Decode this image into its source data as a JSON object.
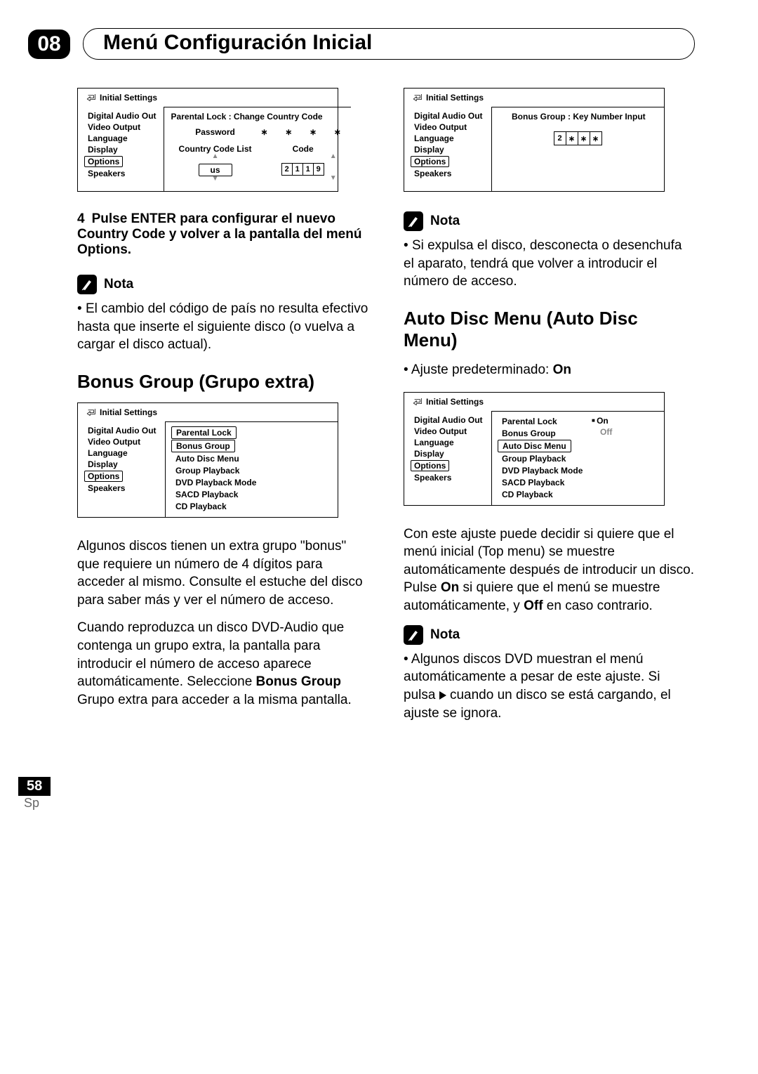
{
  "chapter": {
    "num": "08",
    "title": "Menú Configuración Inicial"
  },
  "page_num": "58",
  "lang": "Sp",
  "panel_title": "Initial Settings",
  "left_menu": {
    "l0": "Digital Audio Out",
    "l1": "Video Output",
    "l2": "Language",
    "l3": "Display",
    "l4": "Options",
    "l5": "Speakers"
  },
  "panel1": {
    "top": "Parental Lock : Change Country Code",
    "password": "Password",
    "cc_list": "Country Code List",
    "code": "Code",
    "us": "us",
    "d0": "2",
    "d1": "1",
    "d2": "1",
    "d3": "9"
  },
  "step4": {
    "num": "4",
    "text_a": "Pulse ENTER para configurar el nuevo Country Code y volver a la pantalla del menú Options."
  },
  "nota": "Nota",
  "note1": "El cambio del código de país no resulta efectivo hasta que inserte el siguiente disco (o vuelva a cargar el disco actual).",
  "h_bonus": "Bonus Group (Grupo extra)",
  "panel2": {
    "o0": "Parental Lock",
    "o1": "Bonus Group",
    "o2": "Auto Disc Menu",
    "o3": "Group Playback",
    "o4": "DVD Playback Mode",
    "o5": "SACD Playback",
    "o6": "CD Playback"
  },
  "bonus_p1": "Algunos discos tienen un extra grupo \"bonus\" que requiere un número de 4 dígitos para acceder al mismo. Consulte el estuche del disco para saber más y ver el número de acceso.",
  "bonus_p2_a": "Cuando reproduzca un disco DVD-Audio que contenga un grupo extra, la pantalla para introducir el número de acceso aparece automáticamente. Seleccione ",
  "bonus_p2_b": "Bonus Group",
  "bonus_p2_c": " Grupo extra para acceder a la misma pantalla.",
  "panel3": {
    "top": "Bonus Group : Key Number Input",
    "d0": "2",
    "star": "∗"
  },
  "note2": "Si expulsa el disco, desconecta o desenchufa el aparato, tendrá que volver a introducir el número de acceso.",
  "h_auto": "Auto Disc Menu (Auto Disc Menu)",
  "auto_default_a": "Ajuste predeterminado: ",
  "auto_default_b": "On",
  "panel4": {
    "on": "On",
    "off": "Off"
  },
  "auto_p1_a": "Con este ajuste puede decidir si quiere que el menú inicial (Top menu) se muestre automáticamente después de introducir un disco. Pulse ",
  "auto_p1_b": "On",
  "auto_p1_c": " si quiere que el menú se muestre automáticamente, y ",
  "auto_p1_d": "Off",
  "auto_p1_e": " en caso contrario.",
  "note3_a": "Algunos discos DVD muestran el menú automáticamente a pesar de este ajuste. Si pulsa ",
  "note3_b": " cuando un disco se está cargando, el ajuste se ignora."
}
